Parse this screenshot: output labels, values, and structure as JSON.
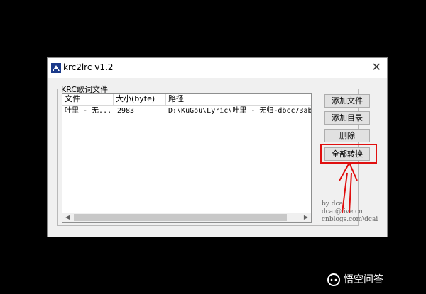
{
  "window": {
    "title": "krc2lrc v1.2",
    "close_glyph": "✕"
  },
  "group": {
    "label": "KRC歌词文件"
  },
  "table": {
    "columns": [
      "文件",
      "大小(byte)",
      "路径"
    ],
    "rows": [
      {
        "file": "叶里 - 无...",
        "size": "2983",
        "path": "D:\\KuGou\\Lyric\\叶里 - 无归-dbcc73ab7"
      }
    ]
  },
  "scrollbar": {
    "left_arrow": "◀",
    "right_arrow": "▶"
  },
  "buttons": {
    "add_file": "添加文件",
    "add_dir": "添加目录",
    "delete": "删除",
    "convert_all": "全部转换"
  },
  "credits": [
    "by dcai",
    "dcai@live.cn",
    "cnblogs.com\\dcai"
  ],
  "watermark": {
    "text": "悟空问答"
  },
  "colors": {
    "highlight": "#e01010",
    "background": "#000000"
  }
}
